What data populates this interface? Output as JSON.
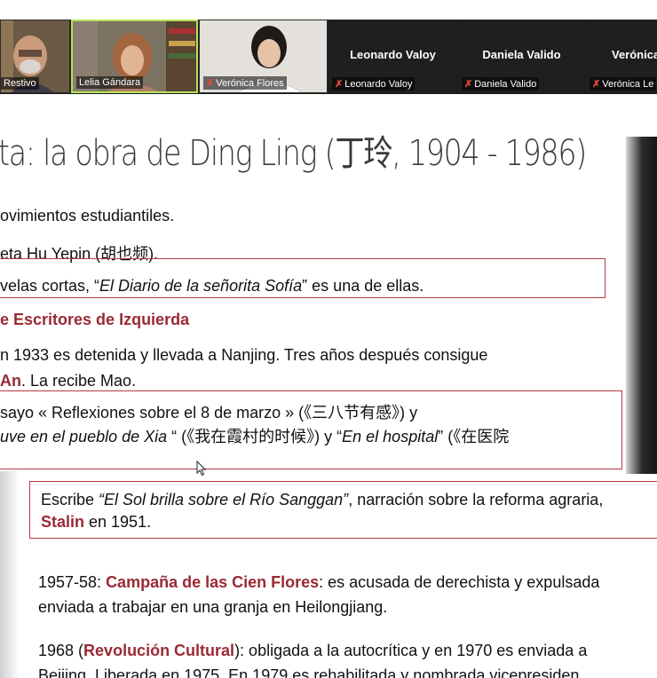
{
  "participants": [
    {
      "name": "Restivo",
      "tag": "Restivo",
      "video": true,
      "muted": false
    },
    {
      "name": "Lelia Gándara",
      "tag": "Lelia Gándara",
      "video": true,
      "muted": false,
      "active": true
    },
    {
      "name": "Verónica Flores",
      "tag": "Verónica Flores",
      "video": true,
      "muted": true
    },
    {
      "name": "Leonardo Valoy",
      "tag": "Leonardo Valoy",
      "video": false,
      "muted": true
    },
    {
      "name": "Daniela Valido",
      "tag": "Daniela Valido",
      "video": false,
      "muted": true
    },
    {
      "name": "Verónica",
      "tag": "Verónica Le",
      "video": false,
      "muted": true
    }
  ],
  "slide": {
    "title": "ta: la obra de Ding Ling (丁玲, 1904 - 1986)",
    "l1": "ovimientos estudiantiles.",
    "l2": "eta Hu Yepin (胡也频).",
    "l3a": "velas cortas, “",
    "l3b": "El Diario de la señorita Sofía",
    "l3c": "” es una de ellas.",
    "l4": "e Escritores de Izquierda",
    "l5": "n 1933 es detenida y llevada a Nanjing. Tres años después consigue",
    "l6a": "An",
    "l6b": ". La recibe Mao.",
    "l7": "sayo « Reflexiones sobre el  8 de marzo » (《三八节有感》) y",
    "l8a": "uve en el pueblo de Xia",
    "l8b": " “ (《我在霞村的时候》) y “",
    "l8c": "En el hospital",
    "l8d": "” (《在医院",
    "l9a": "Escribe ",
    "l9b": "“El Sol brilla sobre el Río Sanggan”",
    "l9c": ", narración sobre la reforma agraria,",
    "l10a": "Stalin",
    "l10b": " en 1951.",
    "l11a": "1957-58: ",
    "l11b": "Campaña de las Cien Flores",
    "l11c": ": es acusada de derechista y expulsada",
    "l12": "enviada a trabajar en una granja en Heilongjiang.",
    "l13a": "1968 (",
    "l13b": "Revolución Cultural",
    "l13c": "): obligada a la autocrítica y en 1970 es enviada a",
    "l14": "Beijing. Liberada en 1975. En 1979 es rehabilitada y nombrada vicepresiden"
  },
  "colors": {
    "accent": "#9a2a35",
    "box": "#b33a44",
    "active_border": "#b7e35a",
    "mute": "#e84a3c"
  }
}
